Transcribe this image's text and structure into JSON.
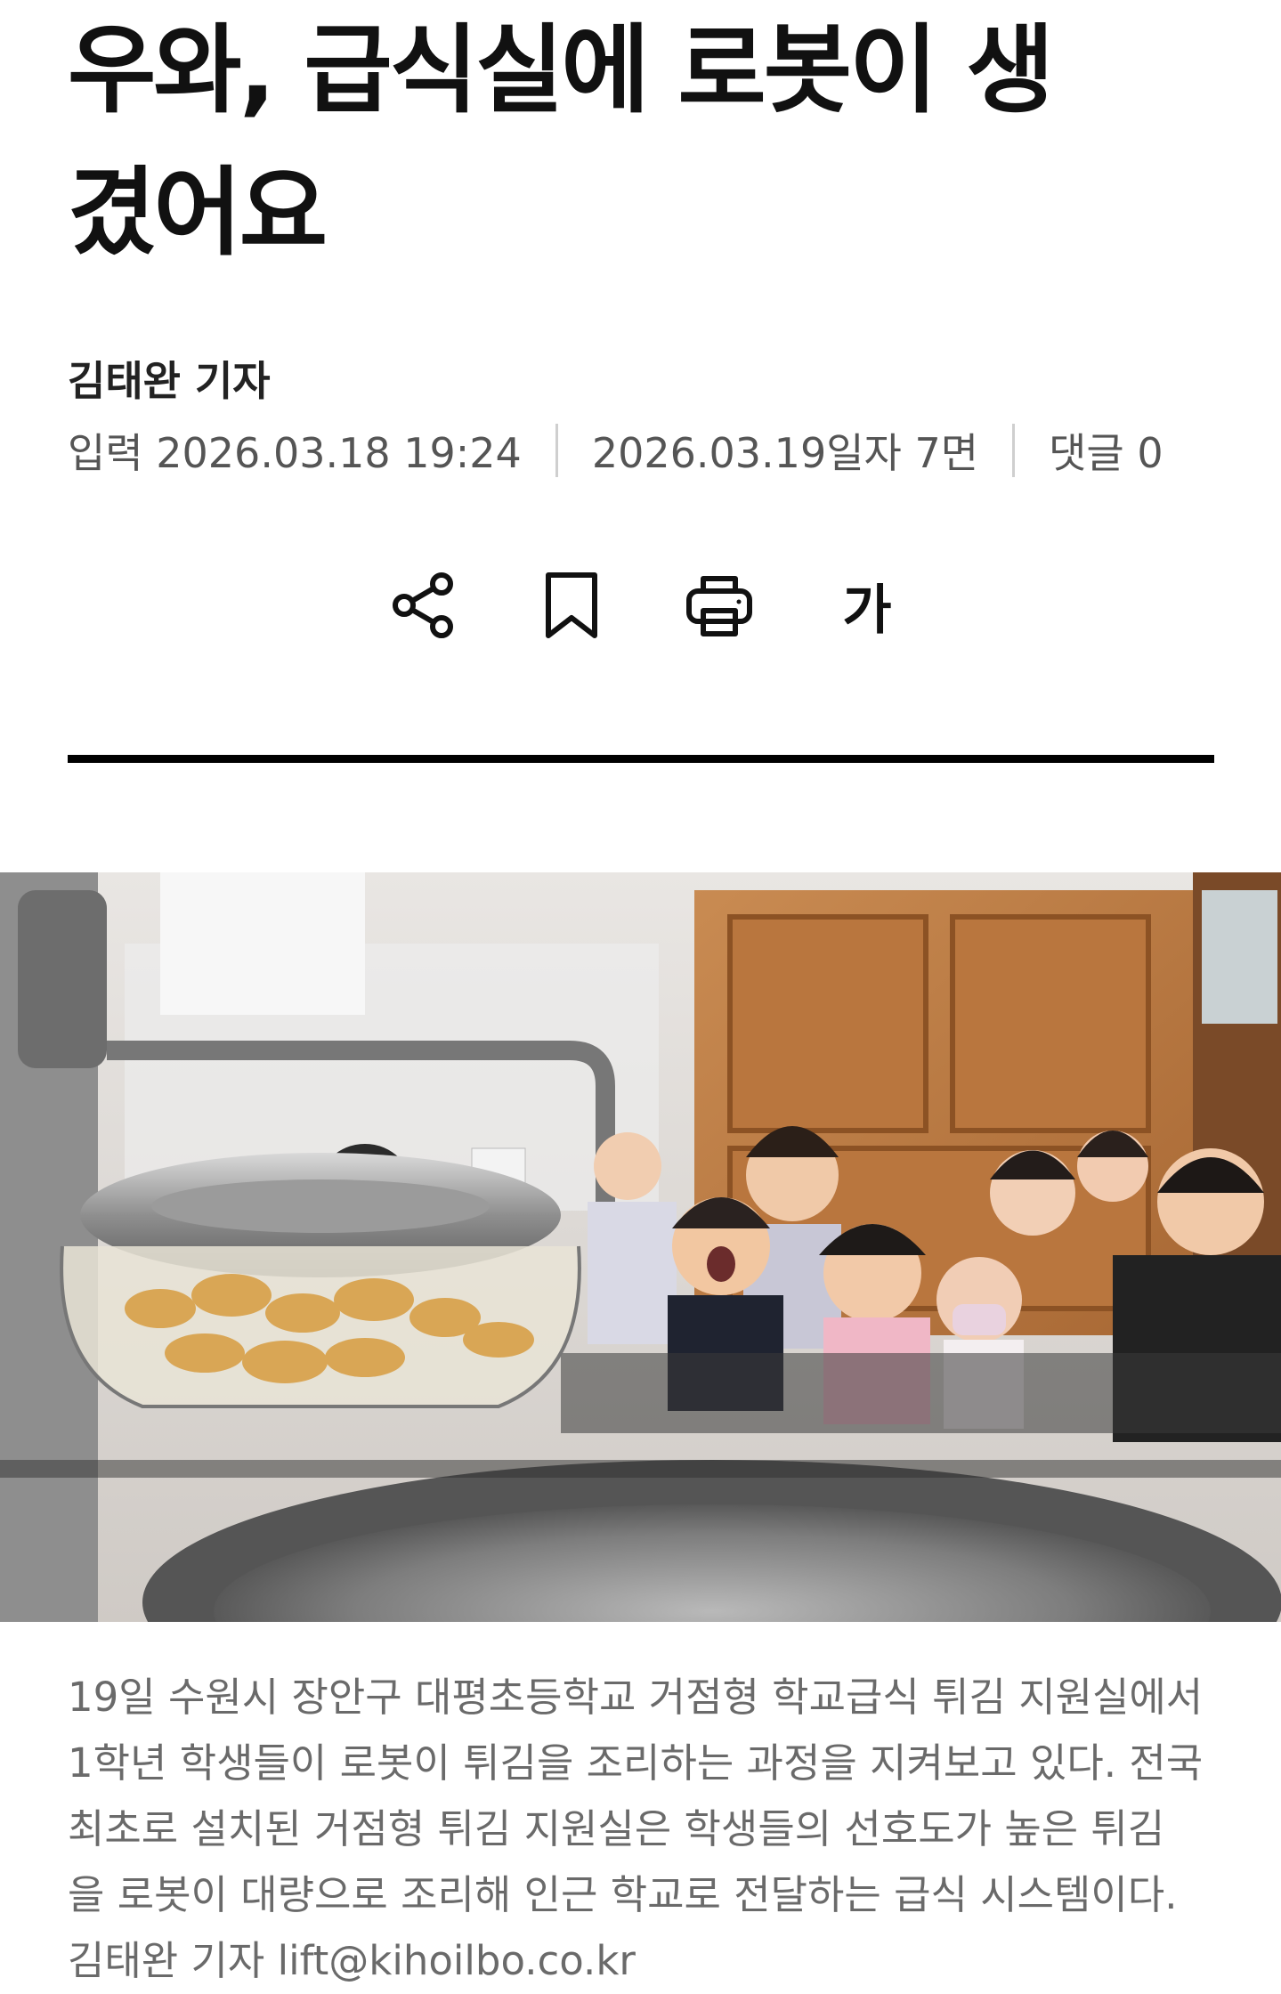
{
  "article": {
    "title_line1": "우와, 급식실에 로봇이 생",
    "title_line2": "겼어요",
    "reporter": "김태완 기자",
    "meta": {
      "input_label": "입력 2026.03.18 19:24",
      "edition": "2026.03.19일자 7면",
      "comments": "댓글 0"
    },
    "tools": {
      "share_icon": "share-icon",
      "bookmark_icon": "bookmark-icon",
      "print_icon": "print-icon",
      "font_size_label": "가"
    },
    "caption_lines": [
      "19일 수원시 장안구 대평초등학교 거점형 학교급식 튀김 지원실에서",
      "1학년 학생들이 로봇이 튀김을 조리하는 과정을 지켜보고 있다. 전국",
      "최초로 설치된 거점형 튀김 지원실은 학생들의 선호도가 높은 튀김",
      "을 로봇이 대량으로 조리해 인근 학교로 전달하는 급식 시스템이다.",
      "김태완 기자 lift@kihoilbo.co.kr"
    ]
  }
}
